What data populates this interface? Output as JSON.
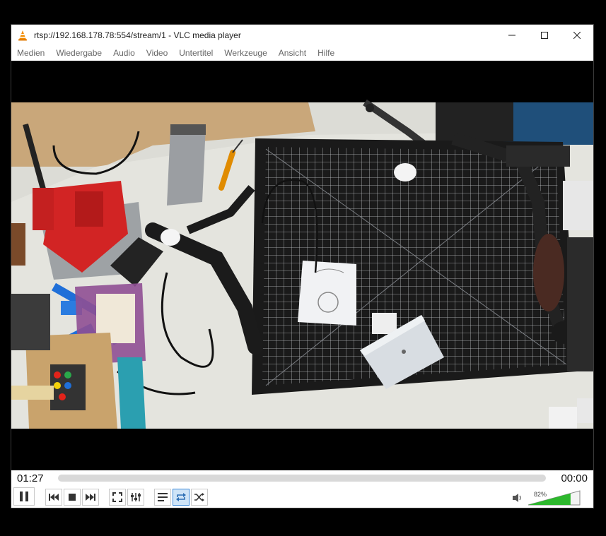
{
  "window": {
    "title": "rtsp://192.168.178.78:554/stream/1 - VLC media player",
    "app_icon": "vlc-cone-icon"
  },
  "menu": {
    "items": [
      {
        "label": "Medien"
      },
      {
        "label": "Wiedergabe"
      },
      {
        "label": "Audio"
      },
      {
        "label": "Video"
      },
      {
        "label": "Untertitel"
      },
      {
        "label": "Werkzeuge"
      },
      {
        "label": "Ansicht"
      },
      {
        "label": "Hilfe"
      }
    ]
  },
  "video": {
    "content": "camera-stream-workbench"
  },
  "playback": {
    "elapsed": "01:27",
    "total": "00:00",
    "progress": 0
  },
  "controls": {
    "buttons": [
      "pause-icon",
      "previous-icon",
      "stop-icon",
      "next-icon",
      "fullscreen-icon",
      "extended-settings-icon",
      "playlist-icon",
      "loop-icon",
      "random-icon"
    ],
    "loop_active": true
  },
  "volume": {
    "label": "82%",
    "level": 0.82,
    "icon": "speaker-icon"
  },
  "colors": {
    "accent": "#3d8ad9",
    "volume_fill": "#2db82d",
    "vlc_orange": "#f28c00"
  }
}
